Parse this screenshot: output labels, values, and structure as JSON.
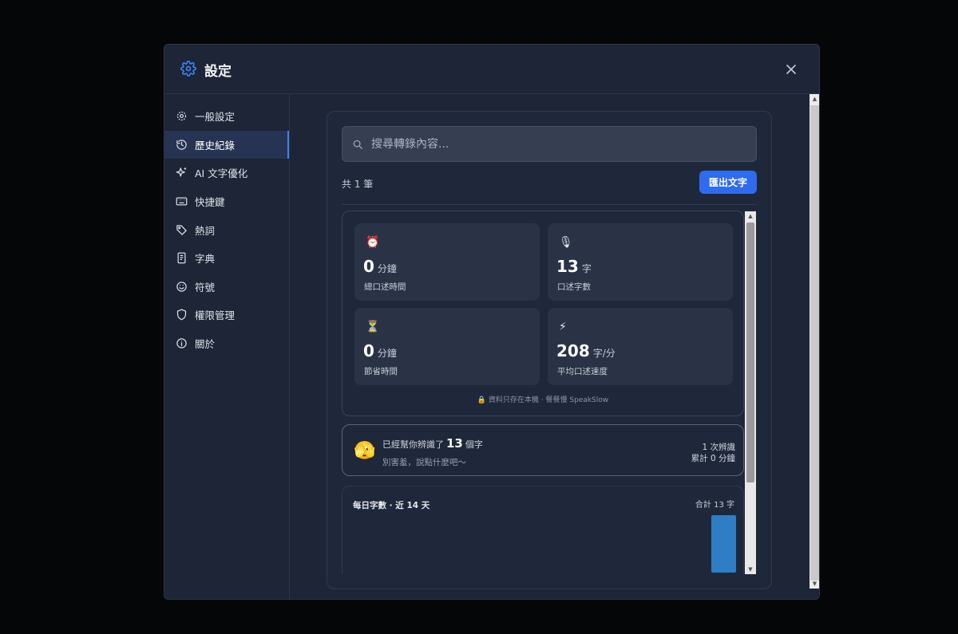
{
  "dialog": {
    "title": "設定",
    "close_icon": "close-icon"
  },
  "sidebar": {
    "items": [
      {
        "label": "一般設定",
        "icon": "gear-icon",
        "active": false
      },
      {
        "label": "歷史紀錄",
        "icon": "history-icon",
        "active": true
      },
      {
        "label": "AI 文字優化",
        "icon": "sparkle-icon",
        "active": false
      },
      {
        "label": "快捷鍵",
        "icon": "keyboard-icon",
        "active": false
      },
      {
        "label": "熱詞",
        "icon": "tag-icon",
        "active": false
      },
      {
        "label": "字典",
        "icon": "book-icon",
        "active": false
      },
      {
        "label": "符號",
        "icon": "smile-icon",
        "active": false
      },
      {
        "label": "權限管理",
        "icon": "shield-icon",
        "active": false
      },
      {
        "label": "關於",
        "icon": "info-icon",
        "active": false
      }
    ]
  },
  "history": {
    "search_placeholder": "搜尋轉錄內容...",
    "count_label": "共 1 筆",
    "export_label": "匯出文字"
  },
  "stats": {
    "cards": [
      {
        "emoji": "⏰",
        "value": "0",
        "unit": "分鐘",
        "label": "總口述時間"
      },
      {
        "emoji": "🎙",
        "value": "13",
        "unit": "字",
        "label": "口述字數"
      },
      {
        "emoji": "⏳",
        "value": "0",
        "unit": "分鐘",
        "label": "節省時間"
      },
      {
        "emoji": "⚡",
        "value": "208",
        "unit": "字/分",
        "label": "平均口述速度"
      }
    ],
    "note": "🔒 資料只存在本機 · 餐餐慢 SpeakSlow"
  },
  "encourage": {
    "emoji": "🫣",
    "prefix": "已經幫你辨識了",
    "count": "13",
    "suffix": "個字",
    "sub": "別害羞，說點什麼吧～",
    "right1": "1 次辨識",
    "right2": "累計 0 分鐘"
  },
  "daily_chart": {
    "title": "每日字數 · 近 14 天",
    "total": "合計 13 字"
  },
  "chart_data": {
    "type": "bar",
    "title": "每日字數 · 近 14 天",
    "categories": [
      "",
      "",
      "",
      "",
      "",
      "",
      "",
      "",
      "",
      "",
      "",
      "",
      "",
      ""
    ],
    "values": [
      0,
      0,
      0,
      0,
      0,
      0,
      0,
      0,
      0,
      0,
      0,
      0,
      0,
      13
    ],
    "ylim": [
      0,
      13
    ],
    "color": "#2f7dc4"
  },
  "colors": {
    "accent": "#2f6bef",
    "active_bg": "#263352",
    "bar": "#2f7dc4"
  }
}
